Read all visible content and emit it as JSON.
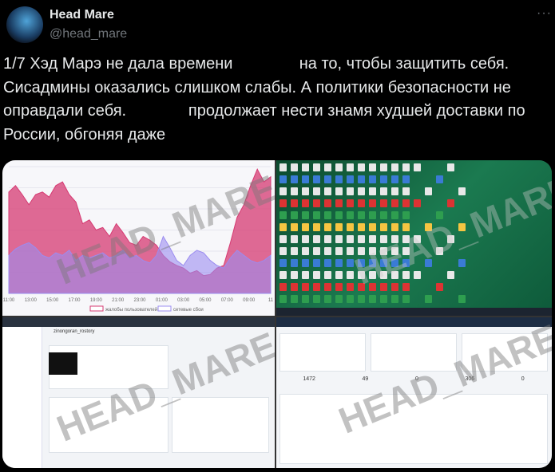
{
  "post": {
    "author_name": "Head Mare",
    "author_handle": "@head_mare",
    "more_icon": "more-icon",
    "text": "1/7 Хэд Марэ не дала времени               на то, чтобы защитить себя.\nСисадмины оказались слишком слабы. А политики безопасности не\nоправдали себя.              продолжает нести знамя худшей доставки по\nРоссии, обгоняя даже"
  },
  "media": {
    "watermark": "HEAD_MARE",
    "vm_name": "zinongoran_rostory",
    "chart_data": {
      "type": "area",
      "x_ticks": [
        "11:00",
        "13:00",
        "15:00",
        "17:00",
        "19:00",
        "21:00",
        "23:00",
        "01:00",
        "03:00",
        "05:00",
        "07:00",
        "09:00",
        "11"
      ],
      "series": [
        {
          "name": "жалобы пользователей",
          "color": "#d63a72",
          "values": [
            80,
            85,
            78,
            70,
            78,
            80,
            76,
            85,
            88,
            78,
            72,
            55,
            58,
            50,
            52,
            45,
            55,
            48,
            40,
            38,
            45,
            42,
            38,
            30,
            25,
            22,
            20,
            16,
            18,
            14,
            15,
            20,
            22,
            40,
            60,
            70,
            85,
            98,
            88,
            92
          ]
        },
        {
          "name": "сетевые сбои",
          "color": "#9b8cf0",
          "values": [
            30,
            35,
            38,
            40,
            36,
            30,
            28,
            32,
            30,
            34,
            26,
            30,
            28,
            30,
            32,
            28,
            30,
            34,
            28,
            30,
            26,
            24,
            30,
            45,
            36,
            26,
            22,
            30,
            34,
            32,
            26,
            22,
            20,
            28,
            34,
            30,
            26,
            24,
            26,
            30
          ]
        }
      ],
      "ylim": [
        0,
        100
      ],
      "grid": true,
      "legend": "bottom"
    },
    "stats": [
      "1472",
      "49",
      "0",
      "306",
      "0"
    ]
  }
}
